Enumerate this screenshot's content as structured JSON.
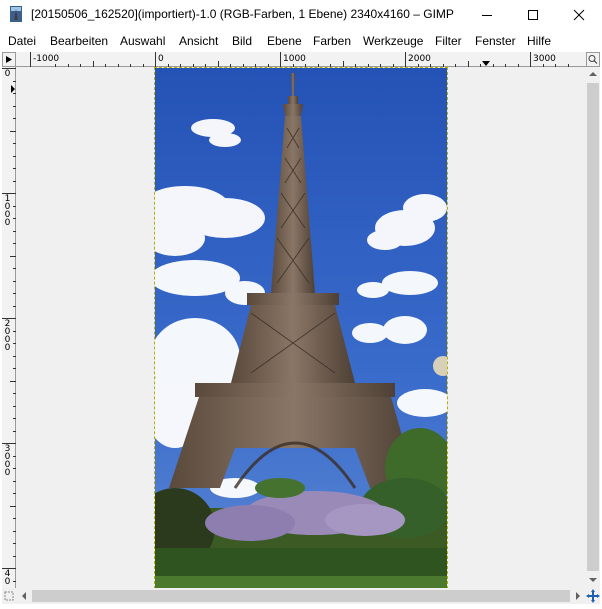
{
  "window": {
    "title": "[20150506_162520](importiert)-1.0 (RGB-Farben, 1 Ebene) 2340x4160 – GIMP"
  },
  "menu": {
    "items": [
      "Datei",
      "Bearbeiten",
      "Auswahl",
      "Ansicht",
      "Bild",
      "Ebene",
      "Farben",
      "Werkzeuge",
      "Filter",
      "Fenster",
      "Hilfe"
    ]
  },
  "rulers": {
    "horizontal_labels": [
      "-1000",
      "0",
      "1000",
      "2000",
      "3000"
    ],
    "vertical_labels": [
      "0",
      "1000",
      "2000",
      "3000",
      "40"
    ]
  },
  "colors": {
    "sky": "#2d59b8",
    "selection_border": "#b8b000",
    "canvas_bg": "#f0f0f0"
  },
  "icons": {
    "app": "gimp-image-icon",
    "minimize": "minimize-icon",
    "maximize": "maximize-icon",
    "close": "close-icon",
    "navigate": "navigate-icon",
    "quick_mask": "quick-mask-icon",
    "zoom": "zoom-icon"
  }
}
